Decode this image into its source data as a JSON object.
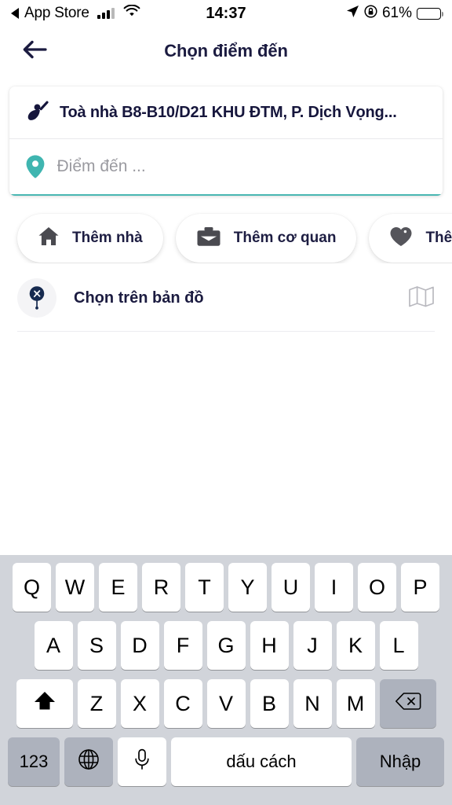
{
  "statusbar": {
    "back_app": "App Store",
    "back_triangle_icon": "triangle-left-icon",
    "signal_icon": "cellular-signal-icon",
    "wifi_icon": "wifi-icon",
    "time": "14:37",
    "location_icon": "location-arrow-icon",
    "rotation_lock_icon": "rotation-lock-icon",
    "battery_percent": "61%",
    "battery_level": 61,
    "battery_icon": "battery-icon"
  },
  "header": {
    "back_icon": "arrow-left-icon",
    "title": "Chọn điểm đến"
  },
  "search_card": {
    "pickup": {
      "icon": "rider-hail-icon",
      "text": "Toà nhà B8-B10/D21 KHU ĐTM, P. Dịch Vọng..."
    },
    "destination": {
      "icon": "map-pin-icon",
      "icon_color": "#3fb5b0",
      "value": "",
      "placeholder": "Điểm đến ...",
      "underline_color": "#49b7b2"
    }
  },
  "quick_chips": [
    {
      "icon": "home-icon",
      "label": "Thêm nhà"
    },
    {
      "icon": "briefcase-icon",
      "label": "Thêm cơ quan"
    },
    {
      "icon": "heart-tag-icon",
      "label": "Thêm địa"
    }
  ],
  "map_row": {
    "badge_icon": "map-marker-pin-icon",
    "label": "Chọn trên bản đồ",
    "trailing_icon": "folded-map-icon"
  },
  "keyboard": {
    "row1": [
      "Q",
      "W",
      "E",
      "R",
      "T",
      "Y",
      "U",
      "I",
      "O",
      "P"
    ],
    "row2": [
      "A",
      "S",
      "D",
      "F",
      "G",
      "H",
      "J",
      "K",
      "L"
    ],
    "row3": [
      "Z",
      "X",
      "C",
      "V",
      "B",
      "N",
      "M"
    ],
    "shift_icon": "shift-arrow-up-icon",
    "backspace_icon": "backspace-delete-icon",
    "numbers_key": "123",
    "globe_icon": "globe-language-icon",
    "mic_icon": "microphone-icon",
    "space_key": "dấu cách",
    "enter_key": "Nhập"
  },
  "colors": {
    "navy": "#1b1b40",
    "teal": "#49b7b2",
    "keyboard_bg": "#d1d4da",
    "key_dark": "#adb2bd"
  }
}
